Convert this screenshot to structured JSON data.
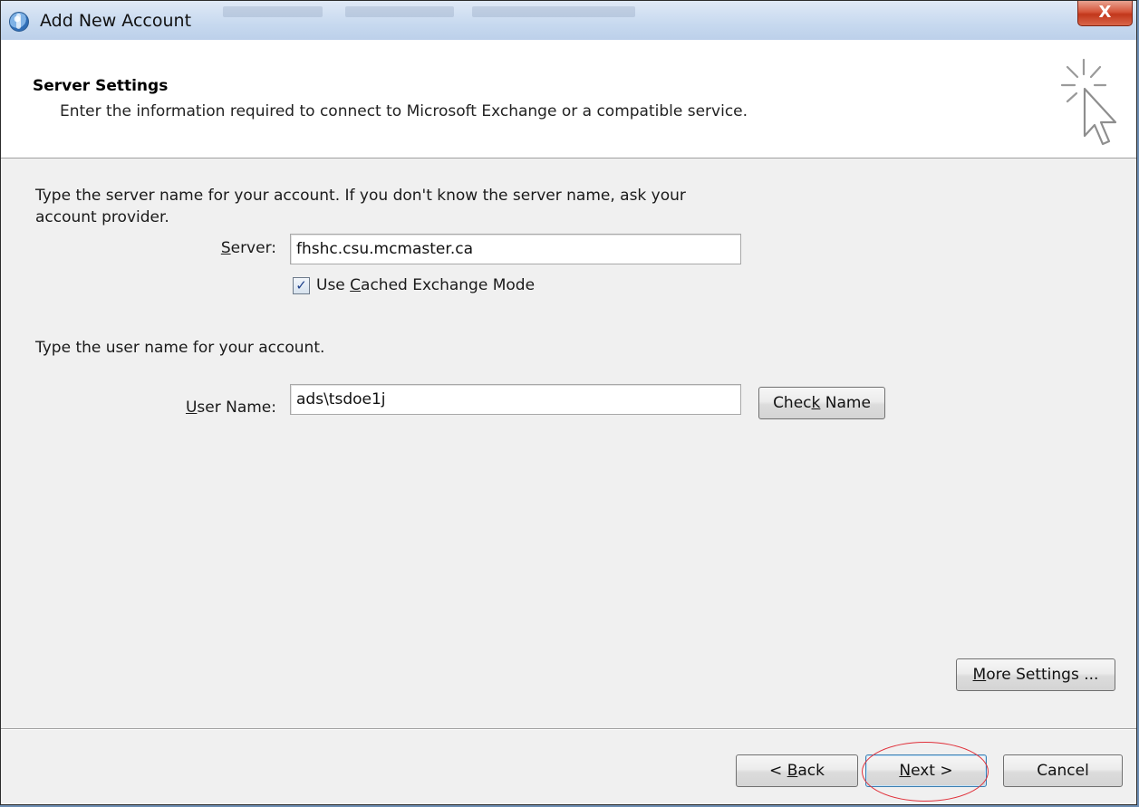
{
  "window": {
    "title": "Add New Account",
    "close_glyph": "X"
  },
  "header": {
    "title": "Server Settings",
    "subtitle": "Enter the information required to connect to Microsoft Exchange or a compatible service.",
    "icon": "cursor-sparkle-icon"
  },
  "server_section": {
    "instruction_line1": "Type the server name for your account. If you don't know the server name, ask your",
    "instruction_line2": "account provider.",
    "server_label": {
      "pre": "",
      "key": "S",
      "post": "erver:"
    },
    "server_value": "fhshc.csu.mcmaster.ca",
    "cached_mode": {
      "checked": true,
      "label": {
        "pre": "Use ",
        "key": "C",
        "post": "ached Exchange Mode"
      }
    }
  },
  "user_section": {
    "instruction": "Type the user name for your account.",
    "user_label": {
      "pre": "",
      "key": "U",
      "post": "ser Name:"
    },
    "user_value": "ads\\tsdoe1j",
    "check_name": {
      "pre": "Chec",
      "key": "k",
      "post": " Name"
    }
  },
  "more_settings": {
    "pre": "",
    "key": "M",
    "post": "ore Settings ..."
  },
  "footer": {
    "back": {
      "pre": "< ",
      "key": "B",
      "post": "ack"
    },
    "next": {
      "pre": "",
      "key": "N",
      "post": "ext >"
    },
    "cancel": "Cancel"
  },
  "colors": {
    "highlight_ellipse": "#e0303a",
    "close_button": "#c2371b",
    "checkmark": "#1d3f8a"
  }
}
